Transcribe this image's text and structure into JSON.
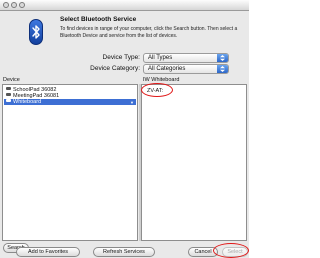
{
  "dialog": {
    "title": "Select Bluetooth Service",
    "description": "To find devices in range of your computer, click the Search button. Then select a Bluetooth Device and service from the list of devices."
  },
  "filters": {
    "device_type_label": "Device Type:",
    "device_type_value": "All Types",
    "device_category_label": "Device Category:",
    "device_category_value": "All Categories"
  },
  "device_list": {
    "header": "Device",
    "items": [
      {
        "label": "SchoolPad 36082",
        "selected": false
      },
      {
        "label": "MeetingPad 36081",
        "selected": false
      },
      {
        "label": "Whiteboard",
        "selected": true
      }
    ]
  },
  "service_list": {
    "header": "IW Whiteboard",
    "items": [
      {
        "label": "ZV-AT:"
      }
    ]
  },
  "buttons": {
    "search": "Search",
    "add_to_favorites": "Add to Favorites",
    "refresh_services": "Refresh Services",
    "cancel": "Cancel",
    "select": "Select"
  },
  "colors": {
    "selection": "#3d6fd4",
    "annotation": "#e01818",
    "popup_arrow": "#2c67c9"
  },
  "icons": {
    "header": "bluetooth-icon",
    "device": "device-icon",
    "popup": "popup-arrows-icon"
  }
}
